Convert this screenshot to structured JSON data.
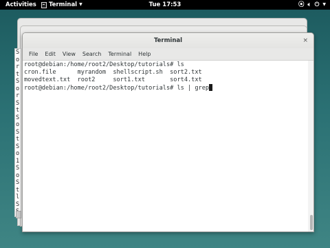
{
  "topbar": {
    "activities": "Activities",
    "app_menu": "Terminal",
    "clock": "Tue 17:53"
  },
  "window": {
    "title": "Terminal",
    "close": "×",
    "menu": [
      "File",
      "Edit",
      "View",
      "Search",
      "Terminal",
      "Help"
    ]
  },
  "terminal": {
    "line1": "root@debian:/home/root2/Desktop/tutorials# ls",
    "line2": "cron.file      myrandom  shellscript.sh  sort2.txt",
    "line3": "movedtext.txt  root2     sort1.txt       sort4.txt",
    "line4": "root@debian:/home/root2/Desktop/tutorials# ls | grep"
  },
  "background_window": {
    "visible_chars": [
      "S",
      "o",
      "r",
      "t",
      "S",
      "o",
      "r",
      "S",
      "t",
      "S",
      "o",
      "S",
      "t",
      "S",
      "o",
      "1",
      "S",
      "o",
      "S",
      "t",
      "l",
      "S",
      "S"
    ]
  }
}
